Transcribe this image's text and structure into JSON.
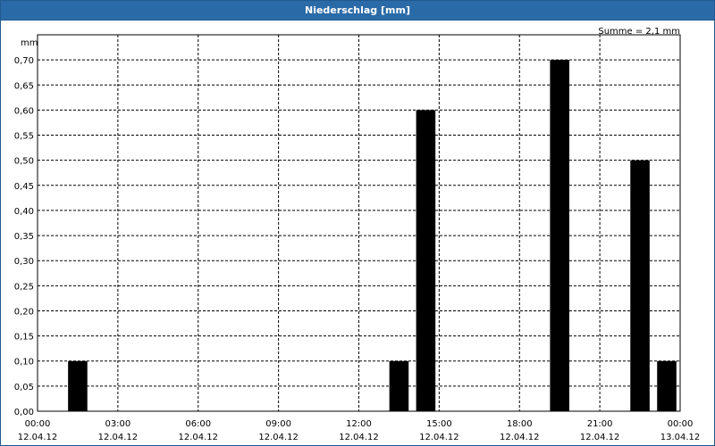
{
  "window": {
    "title": "Niederschlag [mm]"
  },
  "chart_data": {
    "type": "bar",
    "title": "Niederschlag [mm]",
    "ylabel": "mm",
    "annotation": "Summe = 2,1 mm",
    "ylim": [
      0,
      0.75
    ],
    "y_ticks": [
      "0,00",
      "0,05",
      "0,10",
      "0,15",
      "0,20",
      "0,25",
      "0,30",
      "0,35",
      "0,40",
      "0,45",
      "0,50",
      "0,55",
      "0,60",
      "0,65",
      "0,70"
    ],
    "x_ticks": [
      {
        "time": "00:00",
        "date": "12.04.12"
      },
      {
        "time": "03:00",
        "date": "12.04.12"
      },
      {
        "time": "06:00",
        "date": "12.04.12"
      },
      {
        "time": "09:00",
        "date": "12.04.12"
      },
      {
        "time": "12:00",
        "date": "12.04.12"
      },
      {
        "time": "15:00",
        "date": "12.04.12"
      },
      {
        "time": "18:00",
        "date": "12.04.12"
      },
      {
        "time": "21:00",
        "date": "12.04.12"
      },
      {
        "time": "00:00",
        "date": "13.04.12"
      }
    ],
    "grid": true,
    "bar_color": "#000000",
    "bars": [
      {
        "hour": 1,
        "value": 0.1
      },
      {
        "hour": 13,
        "value": 0.1
      },
      {
        "hour": 14,
        "value": 0.6
      },
      {
        "hour": 19,
        "value": 0.7
      },
      {
        "hour": 22,
        "value": 0.5
      },
      {
        "hour": 23,
        "value": 0.1
      }
    ]
  }
}
